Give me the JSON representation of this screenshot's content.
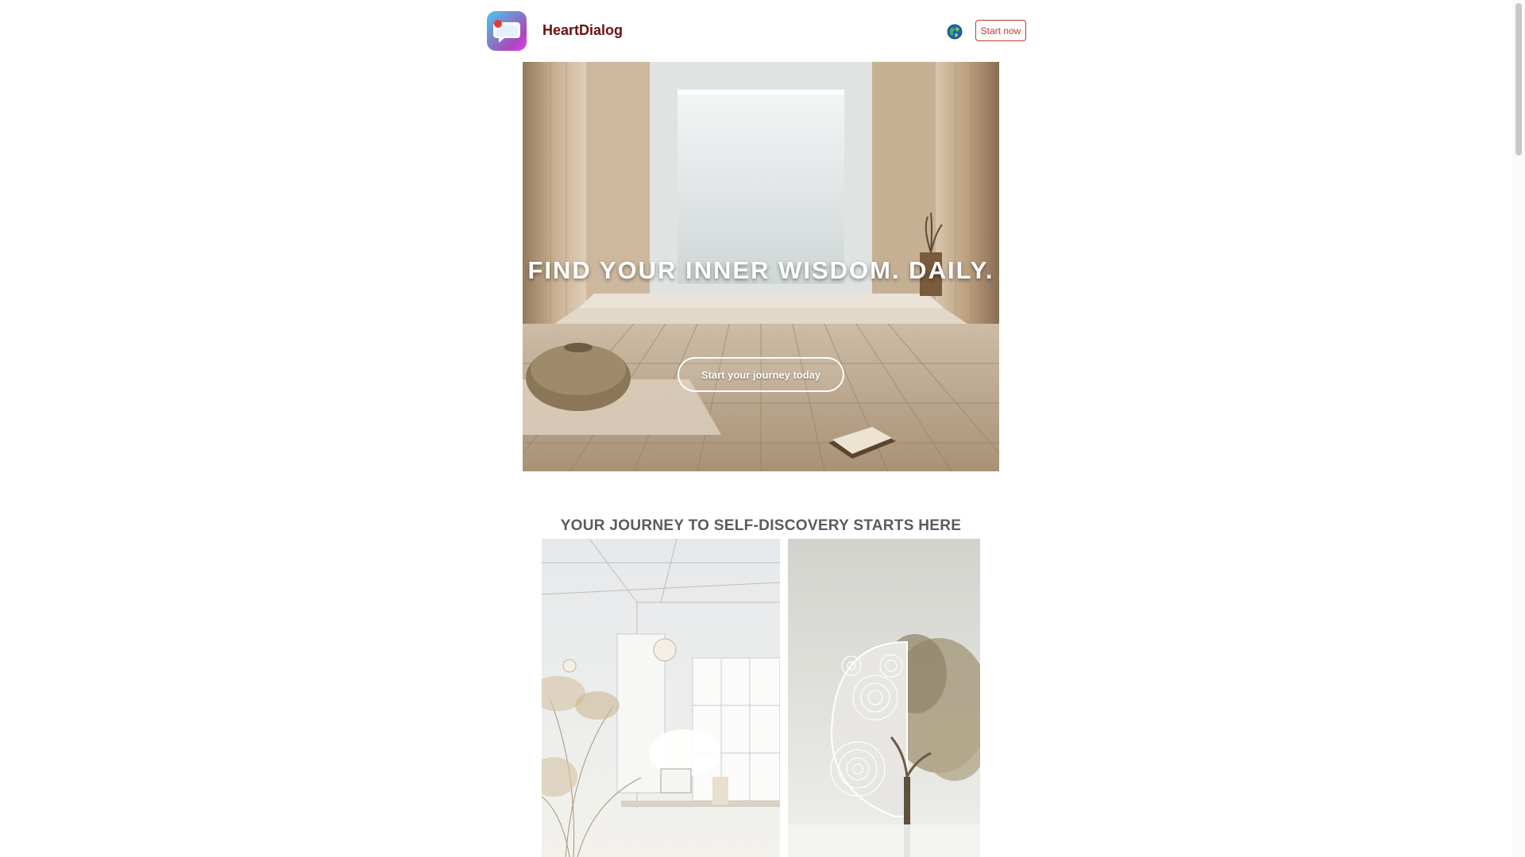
{
  "header": {
    "brand_name": "HeartDialog",
    "start_now_label": "Start now",
    "icons": [
      "app-logo-icon",
      "globe-icon"
    ]
  },
  "hero": {
    "headline": "FIND YOUR INNER WISDOM. DAILY.",
    "cta_label": "Start your journey today"
  },
  "section": {
    "title": "YOUR JOURNEY TO SELF-DISCOVERY STARTS HERE"
  },
  "colors": {
    "brand_text": "#6b1012",
    "accent_button": "#c0392b",
    "section_title": "#5b5b5b"
  }
}
